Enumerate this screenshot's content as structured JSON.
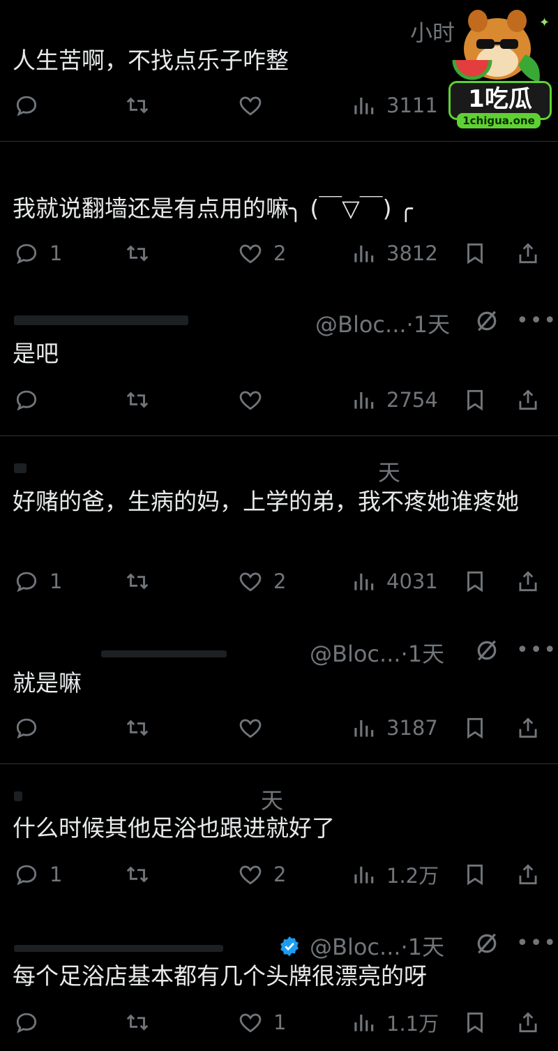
{
  "posts": [
    {
      "timestamp": "小时",
      "text": "人生苦啊，不找点乐子咋整",
      "replies": "",
      "retweets": "",
      "likes": "",
      "views": "3111",
      "has_meta_icons": false,
      "has_bookmark": false
    },
    {
      "timestamp": "",
      "text": "我就说翻墙还是有点用的嘛╮ (￣▽￣) ╭",
      "replies": "1",
      "retweets": "",
      "likes": "2",
      "views": "3812",
      "has_meta_icons": false,
      "has_bookmark": true
    },
    {
      "handle": "@Bloc...",
      "timestamp": "·1天",
      "text": "是吧",
      "replies": "",
      "retweets": "",
      "likes": "",
      "views": "2754",
      "has_meta_icons": true,
      "has_bookmark": true
    },
    {
      "timestamp": "天",
      "text": "好赌的爸，生病的妈，上学的弟，我不疼她谁疼她",
      "replies": "1",
      "retweets": "",
      "likes": "2",
      "views": "4031",
      "has_meta_icons": false,
      "has_bookmark": true
    },
    {
      "handle": "@Bloc...",
      "timestamp": "·1天",
      "text": "就是嘛",
      "replies": "",
      "retweets": "",
      "likes": "",
      "views": "3187",
      "has_meta_icons": true,
      "has_bookmark": true
    },
    {
      "timestamp": "天",
      "text": "什么时候其他足浴也跟进就好了",
      "replies": "1",
      "retweets": "",
      "likes": "2",
      "views": "1.2万",
      "has_meta_icons": false,
      "has_bookmark": true
    },
    {
      "handle": "@Bloc...",
      "timestamp": "·1天",
      "text": "每个足浴店基本都有几个头牌很漂亮的呀",
      "replies": "",
      "retweets": "",
      "likes": "1",
      "views": "1.1万",
      "has_meta_icons": true,
      "has_bookmark": true,
      "verified": true
    }
  ],
  "watermark": {
    "brand": "1吃瓜",
    "url": "1chigua.one"
  },
  "colors": {
    "background": "#000000",
    "text": "#e7e9ea",
    "muted": "#71767b",
    "divider": "#2f3336",
    "verified": "#1d9bf0",
    "watermark_green": "#5fd134"
  },
  "icons": [
    "reply-icon",
    "retweet-icon",
    "like-icon",
    "views-icon",
    "bookmark-icon",
    "share-icon",
    "mute-icon",
    "more-icon",
    "verified-badge-icon"
  ]
}
